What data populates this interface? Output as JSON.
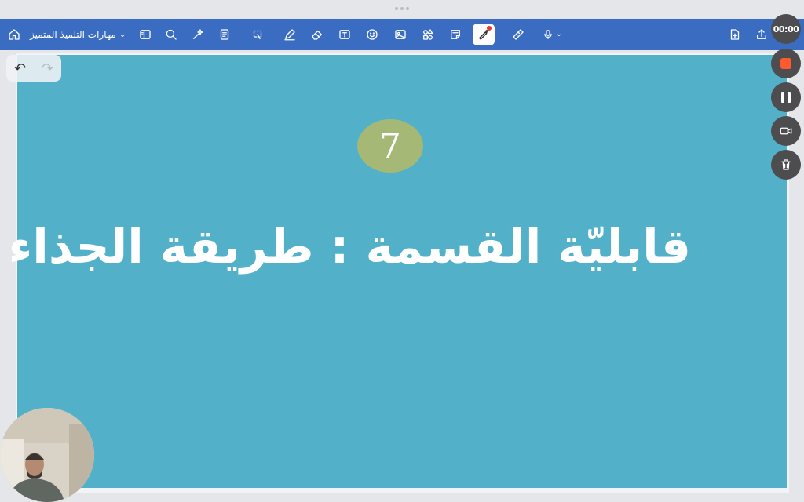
{
  "toolbar": {
    "document_title": "مهارات التلميذ المتميز",
    "icons": [
      "home-icon",
      "chevron-down-icon",
      "sidebar-icon",
      "search-icon",
      "magic-icon",
      "document-icon",
      "lasso-icon",
      "pen-icon",
      "eraser-icon",
      "text-box-icon",
      "sticker-icon",
      "image-icon",
      "shapes-icon",
      "sticky-note-icon",
      "laser-pointer-icon",
      "ruler-icon",
      "microphone-icon",
      "add-page-icon",
      "share-icon"
    ]
  },
  "undo_redo": {
    "undo": "↶",
    "redo": "↷"
  },
  "slide": {
    "badge": "7",
    "title": "قابليّة القسمة : طريقة الجذاء"
  },
  "recorder": {
    "timer": "00:00"
  },
  "colors": {
    "toolbar": "#3a6cc2",
    "slide_bg": "#52b1c9",
    "badge": "#a6b875",
    "stop": "#ff5a2d"
  }
}
